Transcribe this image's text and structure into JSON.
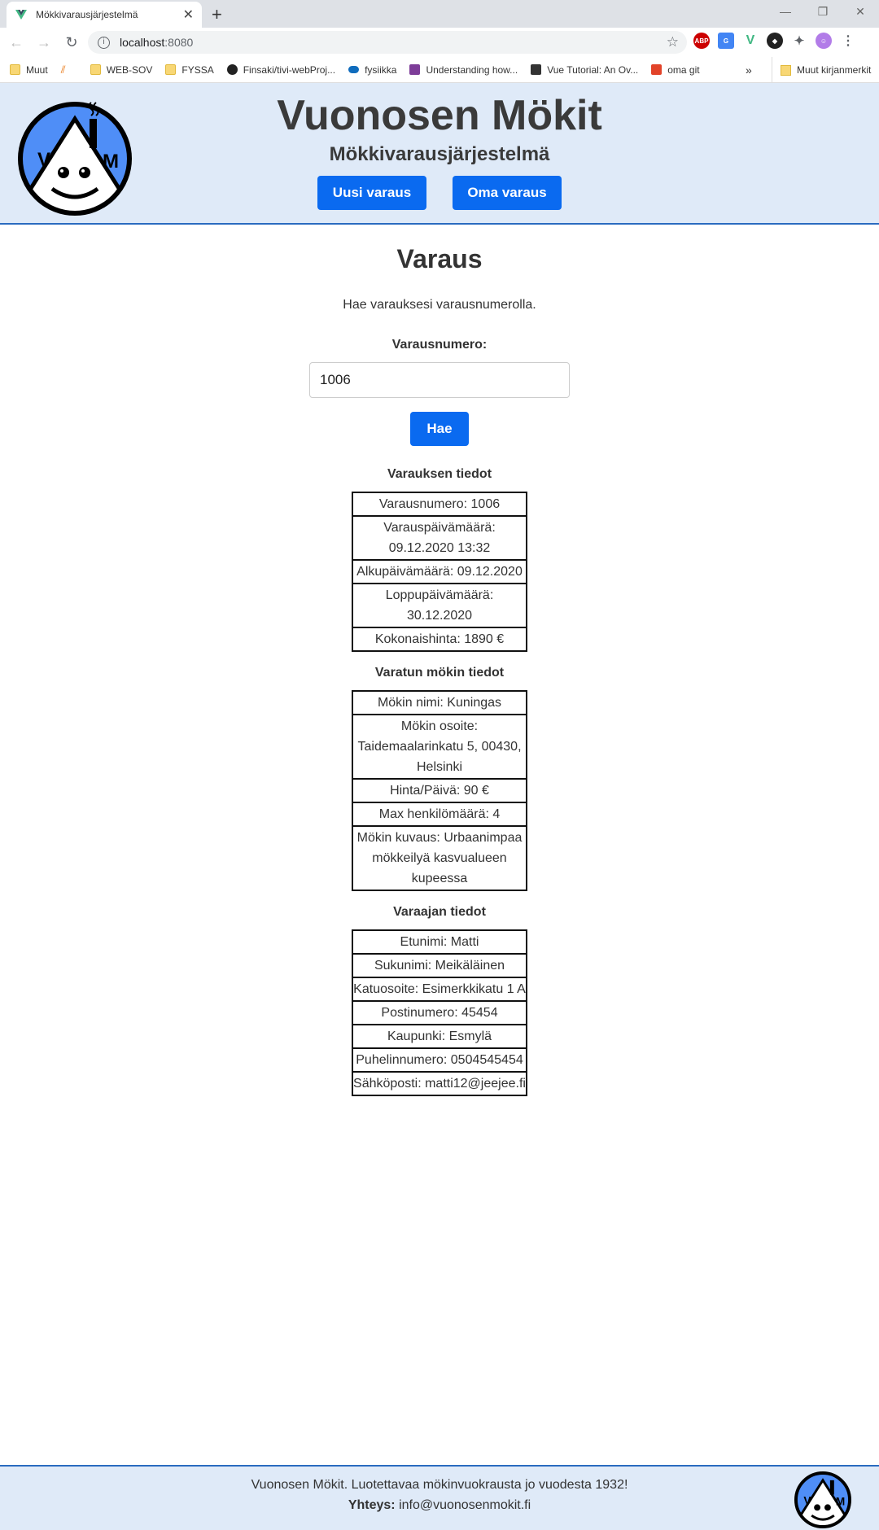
{
  "browser": {
    "tab_title": "Mökkivarausjärjestelmä",
    "url_host": "localhost",
    "url_port": ":8080",
    "bookmarks": [
      {
        "label": "Muut",
        "icon": "folder-icon"
      },
      {
        "label": "",
        "icon": "feather-icon"
      },
      {
        "label": "WEB-SOV",
        "icon": "folder-icon"
      },
      {
        "label": "FYSSA",
        "icon": "folder-icon"
      },
      {
        "label": "Finsaki/tivi-webProj...",
        "icon": "github-icon"
      },
      {
        "label": "fysiikka",
        "icon": "cloud-icon"
      },
      {
        "label": "Understanding how...",
        "icon": "page-icon"
      },
      {
        "label": "Vue Tutorial: An Ov...",
        "icon": "save-icon"
      },
      {
        "label": "oma git",
        "icon": "gitlab-icon"
      }
    ],
    "bookmarks_more": "»",
    "other_bookmarks": "Muut kirjanmerkit"
  },
  "header": {
    "title": "Vuonosen Mökit",
    "subtitle": "Mökkivarausjärjestelmä",
    "logo_letters": [
      "V",
      "M"
    ],
    "nav": {
      "new_booking": "Uusi varaus",
      "own_booking": "Oma varaus"
    }
  },
  "main": {
    "title": "Varaus",
    "intro": "Hae varauksesi varausnumerolla.",
    "field_label": "Varausnumero:",
    "input_value": "1006",
    "search_button": "Hae"
  },
  "reservation": {
    "heading": "Varauksen tiedot",
    "rows": [
      "Varausnumero: 1006",
      "Varauspäivämäärä: 09.12.2020 13:32",
      "Alkupäivämäärä: 09.12.2020",
      "Loppupäivämäärä: 30.12.2020",
      "Kokonaishinta: 1890 €"
    ]
  },
  "cottage": {
    "heading": "Varatun mökin tiedot",
    "rows": [
      "Mökin nimi: Kuningas",
      "Mökin osoite: Taidemaalarinkatu 5, 00430, Helsinki",
      "Hinta/Päivä: 90 €",
      "Max henkilömäärä: 4",
      "Mökin kuvaus: Urbaanimpaa mökkeilyä kasvualueen kupeessa"
    ]
  },
  "customer": {
    "heading": "Varaajan tiedot",
    "rows": [
      "Etunimi: Matti",
      "Sukunimi: Meikäläinen",
      "Katuosoite: Esimerkkikatu 1 A",
      "Postinumero: 45454",
      "Kaupunki: Esmylä",
      "Puhelinnumero: 0504545454",
      "Sähköposti: matti12@jeejee.fi"
    ]
  },
  "footer": {
    "text": "Vuonosen Mökit. Luotettavaa mökinvuokrausta jo vuodesta 1932!",
    "contact_label": "Yhteys:",
    "contact_email": "info@vuonosenmokit.fi"
  },
  "colors": {
    "primary": "#0a6af0",
    "header_bg": "#dfeaf8",
    "accent_border": "#2a6bc0",
    "logo_blue": "#4f8ef7"
  }
}
